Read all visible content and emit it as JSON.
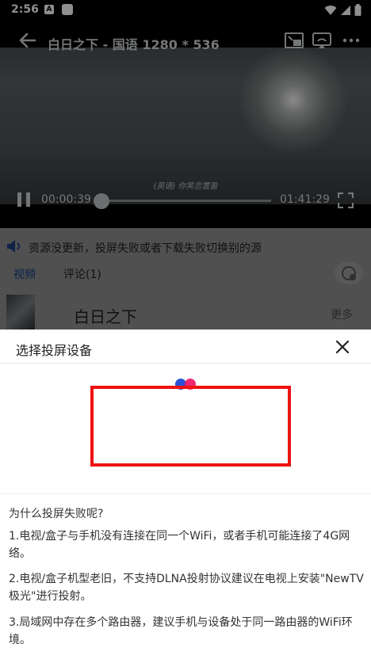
{
  "status_bar": {
    "time": "2:56",
    "notif_letter": "A"
  },
  "player": {
    "title": "白日之下 - 国语 1280 * 536",
    "subtitle_text": "(英语) 你笑恋置盈",
    "current_time": "00:00:39",
    "total_time": "01:41:29",
    "progress": 0.0064
  },
  "notice": {
    "text": "资源没更新，投屏失败或者下载失败切换别的源"
  },
  "tabs": [
    {
      "label": "视频",
      "active": true
    },
    {
      "label": "评论(1)",
      "active": false
    }
  ],
  "movie": {
    "name": "白日之下",
    "more_label": "更多"
  },
  "cast_sheet": {
    "title": "选择投屏设备",
    "help_title": "为什么投屏失败呢?",
    "help_items": [
      "1.电视/盒子与手机没有连接在同一个WiFi，或者手机可能连接了4G网络。",
      "2.电视/盒子机型老旧，不支持DLNA投射协议建议在电视上安装\"NewTV极光\"进行投射。",
      "3.局域网中存在多个路由器，建议手机与设备处于同一路由器的WiFi环境。"
    ]
  },
  "colors": {
    "accent_red": "#ee1111",
    "loading_blue": "#2952d6",
    "loading_pink": "#ee1466",
    "active_tab": "#0b3f86"
  },
  "icons": {
    "back": "back-arrow-icon",
    "pip": "picture-in-picture-icon",
    "cast": "cast-icon",
    "more": "more-dots-icon",
    "pause": "pause-icon",
    "fullscreen": "fullscreen-icon",
    "speaker": "speaker-icon",
    "close": "close-icon"
  }
}
